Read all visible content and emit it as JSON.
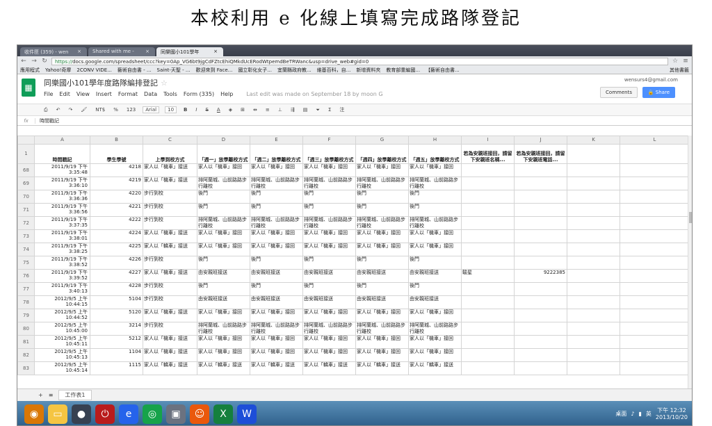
{
  "caption": "本校利用 e 化線上填寫完成路隊登記",
  "browser": {
    "tabs": [
      {
        "label": "收件匣 (359) - wen",
        "active": false
      },
      {
        "label": "Shared with me -",
        "active": false
      },
      {
        "label": "同樂國小101學年",
        "active": true
      }
    ],
    "url_scheme": "https://",
    "url_rest": "docs.google.com/spreadsheet/ccc?key=0Ap_VG6bt9jgCdFZtcEhiQMkdUcERodWtpemdBeTRWanc&usp=drive_web#gid=0",
    "bookmarks": [
      "應用程式",
      "Yahoo!奇摩",
      "2CONV VIDE...",
      "藝術自由書 - ...",
      "Saint-天聖 - ...",
      "歡迎來到 Face...",
      "國立彰化女子...",
      "宜蘭縣政府教...",
      "維基百科，自...",
      "新增資料夾",
      "教育部重編國...",
      "【藝術自由書..."
    ],
    "bookmarks_other": "其他書籤"
  },
  "doc": {
    "title": "同樂國小101學年度路隊編排登記",
    "menu": [
      "File",
      "Edit",
      "View",
      "Insert",
      "Format",
      "Data",
      "Tools",
      "Form (335)",
      "Help"
    ],
    "last_edit": "Last edit was made on September 18 by moon G",
    "user_email": "wensurs4@gmail.com",
    "comments_label": "Comments",
    "share_label": "Share"
  },
  "toolbar": {
    "currency": "NT$",
    "percent": "%",
    "format": "123",
    "font": "Arial",
    "size": "10",
    "bold": "B",
    "italic": "I",
    "strike": "S",
    "underline": "A",
    "comment": "注"
  },
  "formula_bar": {
    "fx": "fx",
    "content": "時間戳記"
  },
  "columns": [
    "A",
    "B",
    "C",
    "D",
    "E",
    "F",
    "G",
    "H",
    "I",
    "J",
    "K",
    "L"
  ],
  "headers": [
    "時間戳記",
    "學生學號",
    "上學到校方式",
    "「週一」放學離校方式",
    "「週二」放學離校方式",
    "「週三」放學離校方式",
    "「週四」放學離校方式",
    "「週五」放學離校方式",
    "若為安親班接回，請留下安親班名稱...",
    "若為安親班接回，請留下安親班電話...",
    "",
    ""
  ],
  "header_row_num": "1",
  "rows": [
    {
      "n": "68",
      "ts": "2011/9/19 下午 3:35:48",
      "id": "4218",
      "go": "家人以「機車」接送",
      "d": [
        "家人以「機車」接回",
        "家人以「機車」接回",
        "家人以「機車」接回",
        "家人以「機車」接回",
        "家人以「機車」接回"
      ],
      "i": "",
      "j": ""
    },
    {
      "n": "69",
      "ts": "2011/9/19 下午 3:36:10",
      "id": "4219",
      "go": "家人以「機車」接送",
      "d": [
        "排阿蘭城、山前路路步行離校",
        "排阿蘭城、山前路路步行離校",
        "排阿蘭城、山前路路步行離校",
        "排阿蘭城、山前路路步行離校",
        "排阿蘭城、山前路路步行離校"
      ],
      "i": "",
      "j": ""
    },
    {
      "n": "70",
      "ts": "2011/9/19 下午 3:36:36",
      "id": "4220",
      "go": "步行到校",
      "d": [
        "後門",
        "後門",
        "後門",
        "後門",
        "後門"
      ],
      "i": "",
      "j": ""
    },
    {
      "n": "71",
      "ts": "2011/9/19 下午 3:36:56",
      "id": "4221",
      "go": "步行到校",
      "d": [
        "後門",
        "後門",
        "後門",
        "後門",
        "後門"
      ],
      "i": "",
      "j": ""
    },
    {
      "n": "72",
      "ts": "2011/9/19 下午 3:37:35",
      "id": "4222",
      "go": "步行到校",
      "d": [
        "排阿蘭城、山前路路步行離校",
        "排阿蘭城、山前路路步行離校",
        "排阿蘭城、山前路路步行離校",
        "排阿蘭城、山前路路步行離校",
        "排阿蘭城、山前路路步行離校"
      ],
      "i": "",
      "j": ""
    },
    {
      "n": "73",
      "ts": "2011/9/19 下午 3:38:01",
      "id": "4224",
      "go": "家人以「機車」接送",
      "d": [
        "家人以「機車」接回",
        "家人以「機車」接回",
        "家人以「機車」接回",
        "家人以「機車」接回",
        "家人以「機車」接回"
      ],
      "i": "",
      "j": ""
    },
    {
      "n": "74",
      "ts": "2011/9/19 下午 3:38:25",
      "id": "4225",
      "go": "家人以「轎車」接送",
      "d": [
        "家人以「機車」接回",
        "家人以「機車」接回",
        "家人以「機車」接回",
        "家人以「機車」接回",
        "家人以「機車」接回"
      ],
      "i": "",
      "j": ""
    },
    {
      "n": "75",
      "ts": "2011/9/19 下午 3:38:52",
      "id": "4226",
      "go": "步行到校",
      "d": [
        "後門",
        "後門",
        "後門",
        "後門",
        "後門"
      ],
      "i": "",
      "j": ""
    },
    {
      "n": "76",
      "ts": "2011/9/19 下午 3:39:52",
      "id": "4227",
      "go": "家人以「機車」接送",
      "d": [
        "由安親班接送",
        "由安親班接送",
        "由安親班接送",
        "由安親班接送",
        "由安親班接送"
      ],
      "i": "駿星",
      "j": "9222385"
    },
    {
      "n": "77",
      "ts": "2011/9/19 下午 3:40:13",
      "id": "4228",
      "go": "步行到校",
      "d": [
        "後門",
        "後門",
        "後門",
        "後門",
        "後門"
      ],
      "i": "",
      "j": ""
    },
    {
      "n": "78",
      "ts": "2012/9/5 上午 10:44:15",
      "id": "5104",
      "go": "步行到校",
      "d": [
        "由安親班接送",
        "由安親班接送",
        "由安親班接送",
        "由安親班接送",
        "由安親班接送"
      ],
      "i": "",
      "j": ""
    },
    {
      "n": "79",
      "ts": "2012/9/5 上午 10:44:52",
      "id": "5120",
      "go": "家人以「機車」接送",
      "d": [
        "家人以「機車」接回",
        "家人以「機車」接回",
        "家人以「機車」接回",
        "家人以「機車」接回",
        "家人以「機車」接回"
      ],
      "i": "",
      "j": ""
    },
    {
      "n": "80",
      "ts": "2012/9/5 上午 10:45:00",
      "id": "3214",
      "go": "步行到校",
      "d": [
        "排阿蘭城、山前路路步行離校",
        "排阿蘭城、山前路路步行離校",
        "排阿蘭城、山前路路步行離校",
        "排阿蘭城、山前路路步行離校",
        "排阿蘭城、山前路路步行離校"
      ],
      "i": "",
      "j": ""
    },
    {
      "n": "81",
      "ts": "2012/9/5 上午 10:45:11",
      "id": "5212",
      "go": "家人以「機車」接送",
      "d": [
        "家人以「機車」接回",
        "家人以「機車」接回",
        "家人以「機車」接回",
        "家人以「機車」接回",
        "家人以「機車」接回"
      ],
      "i": "",
      "j": ""
    },
    {
      "n": "82",
      "ts": "2012/9/5 上午 10:45:13",
      "id": "1104",
      "go": "家人以「機車」接送",
      "d": [
        "家人以「機車」接回",
        "家人以「機車」接回",
        "家人以「機車」接回",
        "家人以「機車」接回",
        "家人以「機車」接回"
      ],
      "i": "",
      "j": ""
    },
    {
      "n": "83",
      "ts": "2012/9/5 上午 10:45:14",
      "id": "1115",
      "go": "家人以「轎車」接送",
      "d": [
        "家人以「轎車」接送",
        "家人以「轎車」接送",
        "家人以「轎車」接送",
        "家人以「轎車」接送",
        "家人以「轎車」接送"
      ],
      "i": "",
      "j": ""
    }
  ],
  "sheet_tab": "工作表1",
  "tray": {
    "desktop_label": "桌面",
    "lang": "英",
    "time": "下午 12:32",
    "date": "2013/10/20"
  }
}
